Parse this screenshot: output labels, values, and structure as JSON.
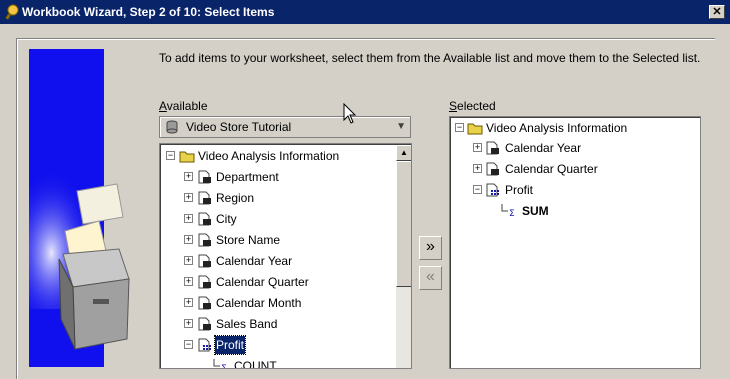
{
  "window": {
    "title": "Workbook Wizard, Step 2 of 10: Select Items",
    "close_label": "✕"
  },
  "instructions": "To add items to your worksheet, select them from the Available list and move them to the Selected list.",
  "available": {
    "label_prefix": "",
    "label_mnemonic": "A",
    "label_rest": "vailable",
    "business_area": "Video Store Tutorial",
    "items": [
      {
        "label": "Video Analysis Information",
        "expander": "−"
      },
      {
        "label": "Department",
        "expander": "+"
      },
      {
        "label": "Region",
        "expander": "+"
      },
      {
        "label": "City",
        "expander": "+"
      },
      {
        "label": "Store Name",
        "expander": "+"
      },
      {
        "label": "Calendar Year",
        "expander": "+"
      },
      {
        "label": "Calendar Quarter",
        "expander": "+"
      },
      {
        "label": "Calendar Month",
        "expander": "+"
      },
      {
        "label": "Sales Band",
        "expander": "+"
      },
      {
        "label": "Profit",
        "expander": "−"
      },
      {
        "label": "COUNT",
        "expander": ""
      }
    ]
  },
  "selected": {
    "label_mnemonic": "S",
    "label_rest": "elected",
    "items": [
      {
        "label": "Video Analysis Information",
        "expander": "−"
      },
      {
        "label": "Calendar Year",
        "expander": "+"
      },
      {
        "label": "Calendar Quarter",
        "expander": "+"
      },
      {
        "label": "Profit",
        "expander": "−"
      },
      {
        "label": "SUM",
        "expander": ""
      }
    ]
  },
  "buttons": {
    "move_right": "»",
    "move_left": "«"
  },
  "colors": {
    "titlebar": "#0a246a",
    "side_graphic": "#1010ee",
    "selection": "#0a246a"
  }
}
